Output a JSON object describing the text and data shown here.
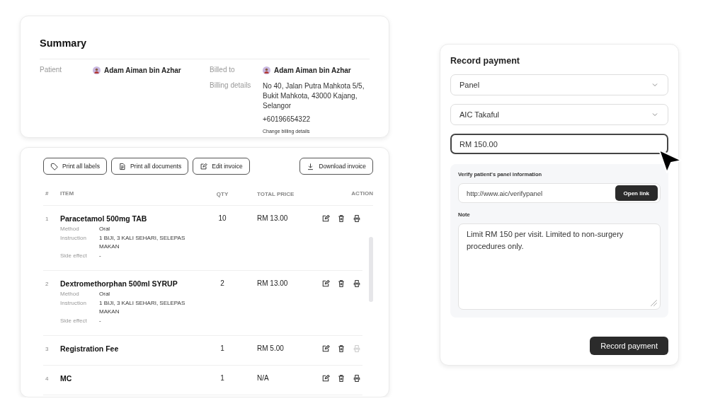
{
  "summary": {
    "title": "Summary",
    "patient": {
      "label": "Patient",
      "name": "Adam Aiman bin Azhar"
    },
    "billed_to": {
      "label": "Billed to",
      "name": "Adam Aiman bin Azhar"
    },
    "billing_details": {
      "label": "Billing details",
      "address": "No 40, Jalan Putra Mahkota 5/5, Bukit Mahkota, 43000 Kajang, Selangor",
      "phone": "+60196654322",
      "link": "Change billing details"
    }
  },
  "toolbar": [
    {
      "kind": "tag",
      "label": "Print all labels"
    },
    {
      "kind": "document",
      "label": "Print all documents"
    },
    {
      "kind": "edit",
      "label": "Edit invoice"
    },
    {
      "kind": "download",
      "label": "Download invoice"
    }
  ],
  "table": {
    "columns": [
      "#",
      "ITEM",
      "QTY",
      "TOTAL PRICE",
      "ACTION"
    ],
    "rows": [
      {
        "number": "1",
        "item": "Paracetamol 500mg TAB",
        "qty": "10",
        "total_price": "RM 13.00",
        "details": [
          {
            "label": "Method",
            "value": "Oral"
          },
          {
            "label": "Instruction",
            "value": "1 BIJI, 3 KALI SEHARI, SELEPAS MAKAN"
          },
          {
            "label": "Side effect",
            "value": "-"
          }
        ],
        "print_disabled": false
      },
      {
        "number": "2",
        "item": "Dextromethorphan 500ml SYRUP",
        "qty": "2",
        "total_price": "RM 13.00",
        "details": [
          {
            "label": "Method",
            "value": "Oral"
          },
          {
            "label": "Instruction",
            "value": "1 BIJI, 3 KALI SEHARI, SELEPAS MAKAN"
          },
          {
            "label": "Side effect",
            "value": "-"
          }
        ],
        "print_disabled": false
      },
      {
        "number": "3",
        "item": "Registration Fee",
        "qty": "1",
        "total_price": "RM 5.00",
        "print_disabled": true
      },
      {
        "number": "4",
        "item": "MC",
        "qty": "1",
        "total_price": "N/A",
        "print_disabled": false
      }
    ]
  },
  "payment": {
    "title": "Record payment",
    "selects": [
      {
        "value": "Panel"
      },
      {
        "value": "AIC Takaful"
      }
    ],
    "amount": {
      "value": "RM 150.00",
      "focused": true
    },
    "panel_info": {
      "label": "Verify patient's panel information",
      "url": "http://www.aic/verifypanel",
      "button": "Open link"
    },
    "note": {
      "label": "Note",
      "value": "Limit RM 150 per visit. Limited to non-surgery procedures only."
    },
    "submit": "Record payment"
  }
}
